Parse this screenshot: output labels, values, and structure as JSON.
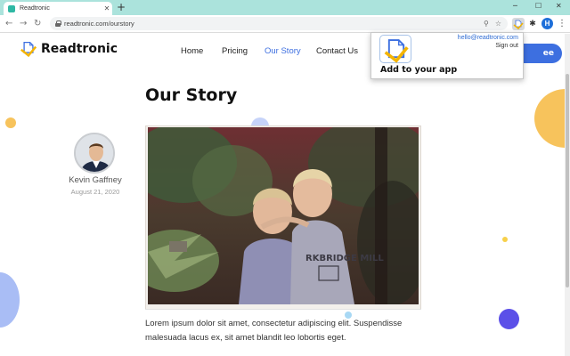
{
  "browser": {
    "tab_title": "Readtronic",
    "tab_close": "✕",
    "new_tab": "+",
    "minimize": "─",
    "maximize": "☐",
    "close": "✕",
    "back": "←",
    "forward": "→",
    "reload": "↻",
    "url": "readtronic.com/ourstory",
    "zoom_icon": "⚲",
    "star_icon": "☆",
    "puzzle_icon": "✱",
    "profile_initial": "H",
    "menu": "⋮"
  },
  "site": {
    "brand": "Readtronic",
    "nav": [
      "Home",
      "Pricing",
      "Our Story",
      "Contact Us"
    ],
    "active_nav": "Our Story",
    "cta_label": "ee"
  },
  "article": {
    "title": "Our Story",
    "author": "Kevin Gaffney",
    "date": "August 21, 2020",
    "body": "Lorem ipsum dolor sit amet, consectetur adipiscing elit. Suspendisse malesuada lacus ex, sit amet blandit leo lobortis eget.",
    "photo_caption_text": "RKBRIDGE MILL"
  },
  "popup": {
    "email": "hello@readtronic.com",
    "signout": "Sign out",
    "add_label": "Add to your app"
  },
  "colors": {
    "accent": "#3d6fe0",
    "tabbar": "#abe3dc",
    "deco_yellow": "#f7c35c",
    "deco_blue": "#a9bdf5",
    "deco_purple": "#5b4fe8"
  }
}
